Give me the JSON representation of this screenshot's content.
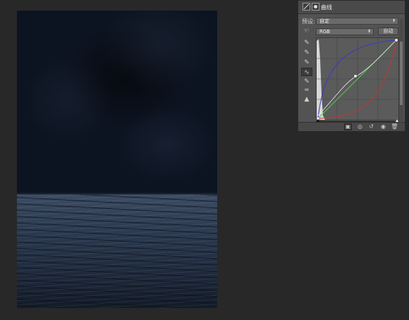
{
  "panel": {
    "title": "曲线",
    "preset_label": "预设:",
    "preset_value": "自定",
    "channel_value": "RGB",
    "auto_button": "自动"
  },
  "curves": {
    "channels": [
      {
        "name": "RGB",
        "color": "#e8e8e8"
      },
      {
        "name": "Red",
        "color": "#c0392b"
      },
      {
        "name": "Green",
        "color": "#4ad04a"
      },
      {
        "name": "Blue",
        "color": "#3a3ac8"
      }
    ]
  },
  "icons": {
    "adjustment": "curves-adjustment-icon",
    "mask": "layer-mask-icon",
    "hand": "on-image-adjust-icon",
    "tools": [
      "sample-black-eyedropper-icon",
      "sample-gray-eyedropper-icon",
      "sample-white-eyedropper-icon",
      "edit-points-icon",
      "draw-curve-icon",
      "smooth-icon",
      "clipping-warning-icon"
    ],
    "footer": [
      "clip-to-layer-icon",
      "view-previous-icon",
      "reset-icon",
      "visibility-eye-icon",
      "delete-icon"
    ]
  },
  "colors": {
    "workspace": "#282828",
    "panel": "#535353",
    "sky": "#0d1421",
    "sea": "#2b3a50"
  }
}
